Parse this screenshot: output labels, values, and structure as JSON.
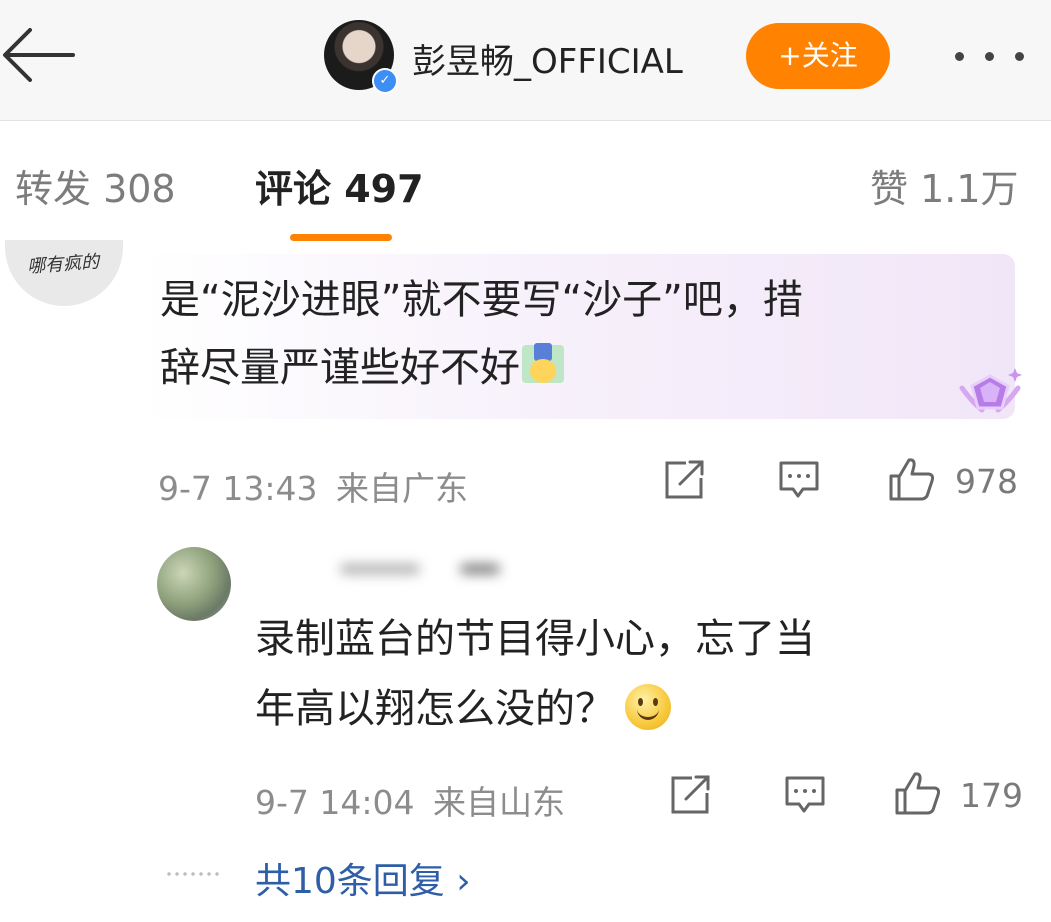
{
  "header": {
    "author_name": "彭昱畅_OFFICIAL",
    "follow_label": "+关注",
    "verified": true
  },
  "tabs": {
    "repost": "转发 308",
    "comments": "评论 497",
    "likes": "赞 1.1万",
    "active": "comments"
  },
  "comments": [
    {
      "avatar_text": "哪有疯的",
      "line1": "是“泥沙进眼”就不要写“沙子”吧，措",
      "line2": "辞尽量严谨些好不好",
      "emoji": "upside-down-face-icon",
      "timestamp": "9-7 13:43",
      "location": "来自广东",
      "like_count": "978",
      "highlighted": true
    },
    {
      "line1": "录制蓝台的节目得小心，忘了当",
      "line2": "年高以翔怎么没的？",
      "emoji": "smile-icon",
      "timestamp": "9-7 14:04",
      "location": "来自山东",
      "like_count": "179"
    }
  ],
  "replies_link": "共10条回复 ›",
  "colors": {
    "accent": "#ff8200",
    "link": "#2e5ea8",
    "highlight": "#f1e6f8"
  }
}
